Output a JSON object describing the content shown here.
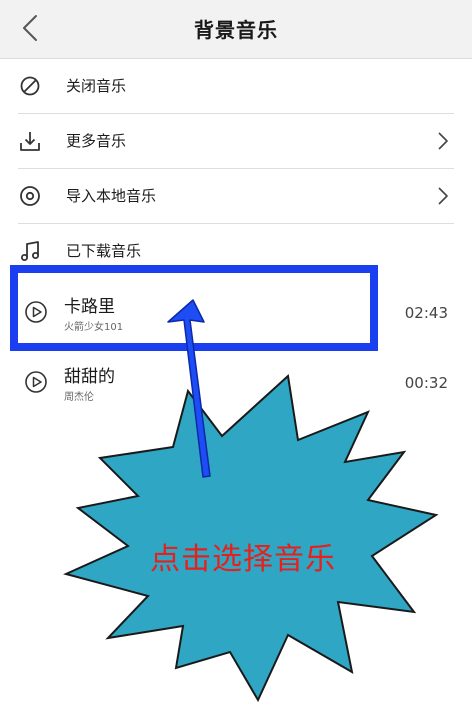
{
  "header": {
    "title": "背景音乐",
    "back_icon": "chevron-left-icon"
  },
  "menu": [
    {
      "label": "关闭音乐",
      "icon": "no-music-icon",
      "has_chevron": false
    },
    {
      "label": "更多音乐",
      "icon": "download-icon",
      "has_chevron": true
    },
    {
      "label": "导入本地音乐",
      "icon": "disc-icon",
      "has_chevron": true
    },
    {
      "label": "已下载音乐",
      "icon": "music-note-icon",
      "has_chevron": false
    }
  ],
  "songs": [
    {
      "title": "卡路里",
      "artist": "火箭少女101",
      "duration": "02:43",
      "highlighted": true
    },
    {
      "title": "甜甜的",
      "artist": "周杰伦",
      "duration": "00:32",
      "highlighted": false
    }
  ],
  "annotation": {
    "callout_text": "点击选择音乐",
    "highlight_color": "#1a3ff0",
    "arrow_color": "#1e4cf5",
    "burst_fill": "#2ea6c4",
    "text_color": "#e8201c"
  }
}
